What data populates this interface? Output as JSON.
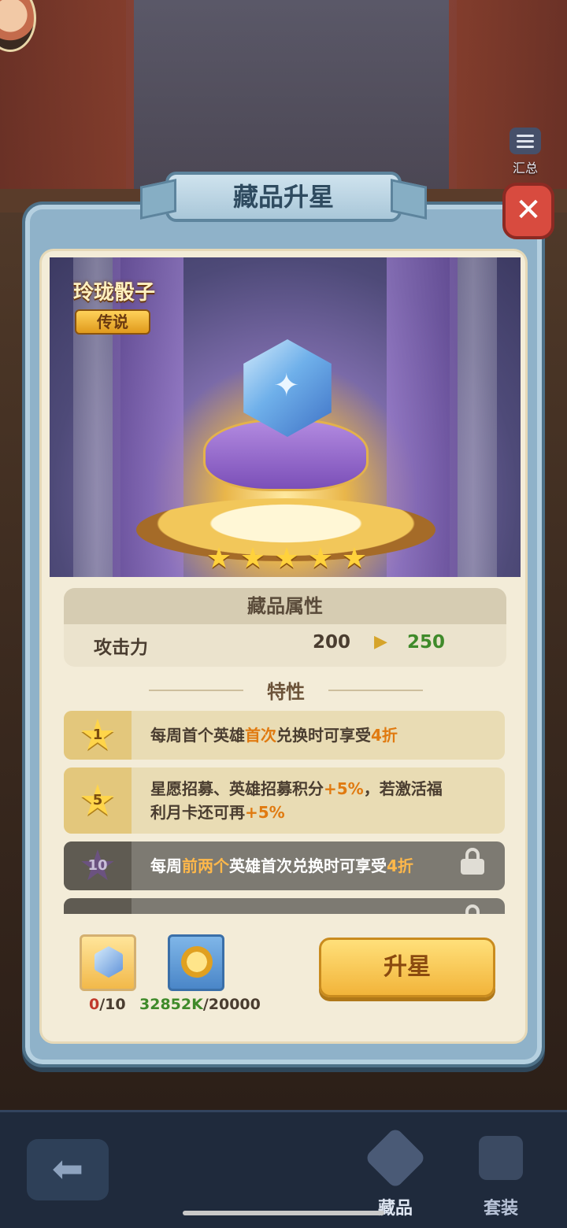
{
  "header": {
    "summary_label": "汇总"
  },
  "dialog": {
    "title": "藏品升星",
    "item": {
      "name": "玲珑骰子",
      "rarity": "传说",
      "stars": 5
    },
    "attributes": {
      "heading": "藏品属性",
      "rows": [
        {
          "name": "攻击力",
          "current": "200",
          "next": "250"
        }
      ]
    },
    "traits_heading": "特性",
    "traits": [
      {
        "level": "1",
        "locked": false,
        "parts": [
          "每周首个英雄",
          "首次",
          "兑换时可享受",
          "4折",
          ""
        ]
      },
      {
        "level": "5",
        "locked": false,
        "parts": [
          "星愿招募、英雄招募积分",
          "+5%",
          "，若激活福利月卡还可再",
          "+5%",
          ""
        ]
      },
      {
        "level": "10",
        "locked": true,
        "parts": [
          "每周",
          "前两个",
          "英雄首次兑换时可享受",
          "4折",
          ""
        ]
      },
      {
        "level": "",
        "locked": true,
        "parts": [
          "",
          "",
          "",
          "",
          ""
        ]
      }
    ],
    "cost": {
      "dice": {
        "have": "0",
        "need": "/10"
      },
      "coin": {
        "have": "32852K",
        "need": "/20000"
      }
    },
    "upgrade_label": "升星"
  },
  "nav": {
    "items": [
      {
        "label": "藏品",
        "active": true
      },
      {
        "label": "套装",
        "active": false
      }
    ]
  }
}
